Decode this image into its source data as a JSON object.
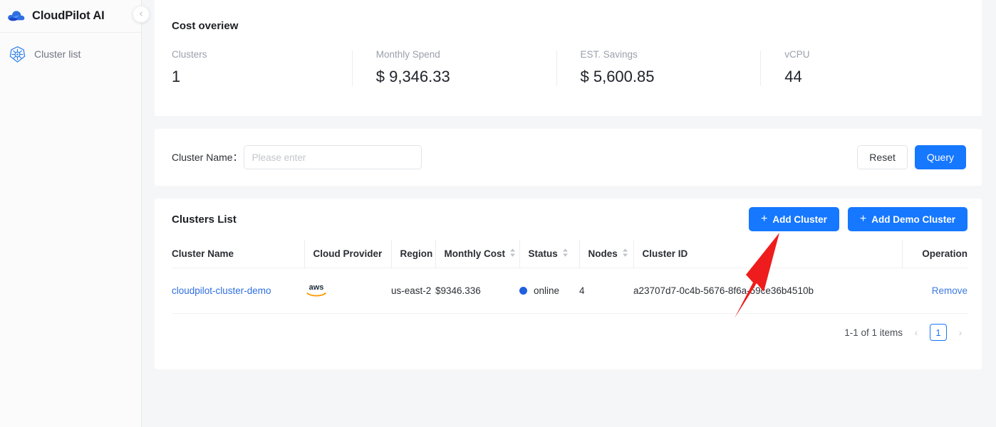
{
  "sidebar": {
    "brand": {
      "title": "CloudPilot AI",
      "logo_icon": "cloud-logo-icon"
    },
    "collapse_icon": "chevron-left-icon",
    "items": [
      {
        "label": "Cluster list",
        "icon": "kubernetes-icon"
      }
    ]
  },
  "cost_overview": {
    "title": "Cost overiew",
    "stats": [
      {
        "label": "Clusters",
        "value": "1"
      },
      {
        "label": "Monthly Spend",
        "value": "$ 9,346.33"
      },
      {
        "label": "EST. Savings",
        "value": "$ 5,600.85"
      },
      {
        "label": "vCPU",
        "value": "44"
      }
    ]
  },
  "filter": {
    "label": "Cluster Name：",
    "input_value": "",
    "input_placeholder": "Please enter",
    "reset_label": "Reset",
    "query_label": "Query"
  },
  "clusters_list": {
    "title": "Clusters List",
    "add_cluster_label": "Add Cluster",
    "add_demo_cluster_label": "Add Demo Cluster",
    "plus_glyph": "+",
    "columns": [
      {
        "label": "Cluster Name",
        "sortable": false
      },
      {
        "label": "Cloud Provider",
        "sortable": false
      },
      {
        "label": "Region",
        "sortable": false
      },
      {
        "label": "Monthly Cost",
        "sortable": true
      },
      {
        "label": "Status",
        "sortable": true
      },
      {
        "label": "Nodes",
        "sortable": true
      },
      {
        "label": "Cluster ID",
        "sortable": false
      },
      {
        "label": "Operation",
        "sortable": false
      }
    ],
    "rows": [
      {
        "cluster_name": "cloudpilot-cluster-demo",
        "cloud_provider_icon": "aws-logo-icon",
        "region": "us-east-2",
        "monthly_cost": "$9346.336",
        "status": "online",
        "status_color": "#1f5fe0",
        "nodes": "4",
        "cluster_id": "a23707d7-0c4b-5676-8f6a-59ce36b4510b",
        "operation": "Remove"
      }
    ],
    "pagination": {
      "summary": "1-1 of 1 items",
      "prev_icon": "chevron-left-icon",
      "next_icon": "chevron-right-icon",
      "current_page": "1"
    }
  },
  "annotation": {
    "arrow_icon": "red-arrow-icon",
    "arrow_color": "#ee1c1c"
  },
  "theme": {
    "primary": "#1677ff",
    "link": "#2f6fe0",
    "page_bg": "#f5f6f8"
  }
}
